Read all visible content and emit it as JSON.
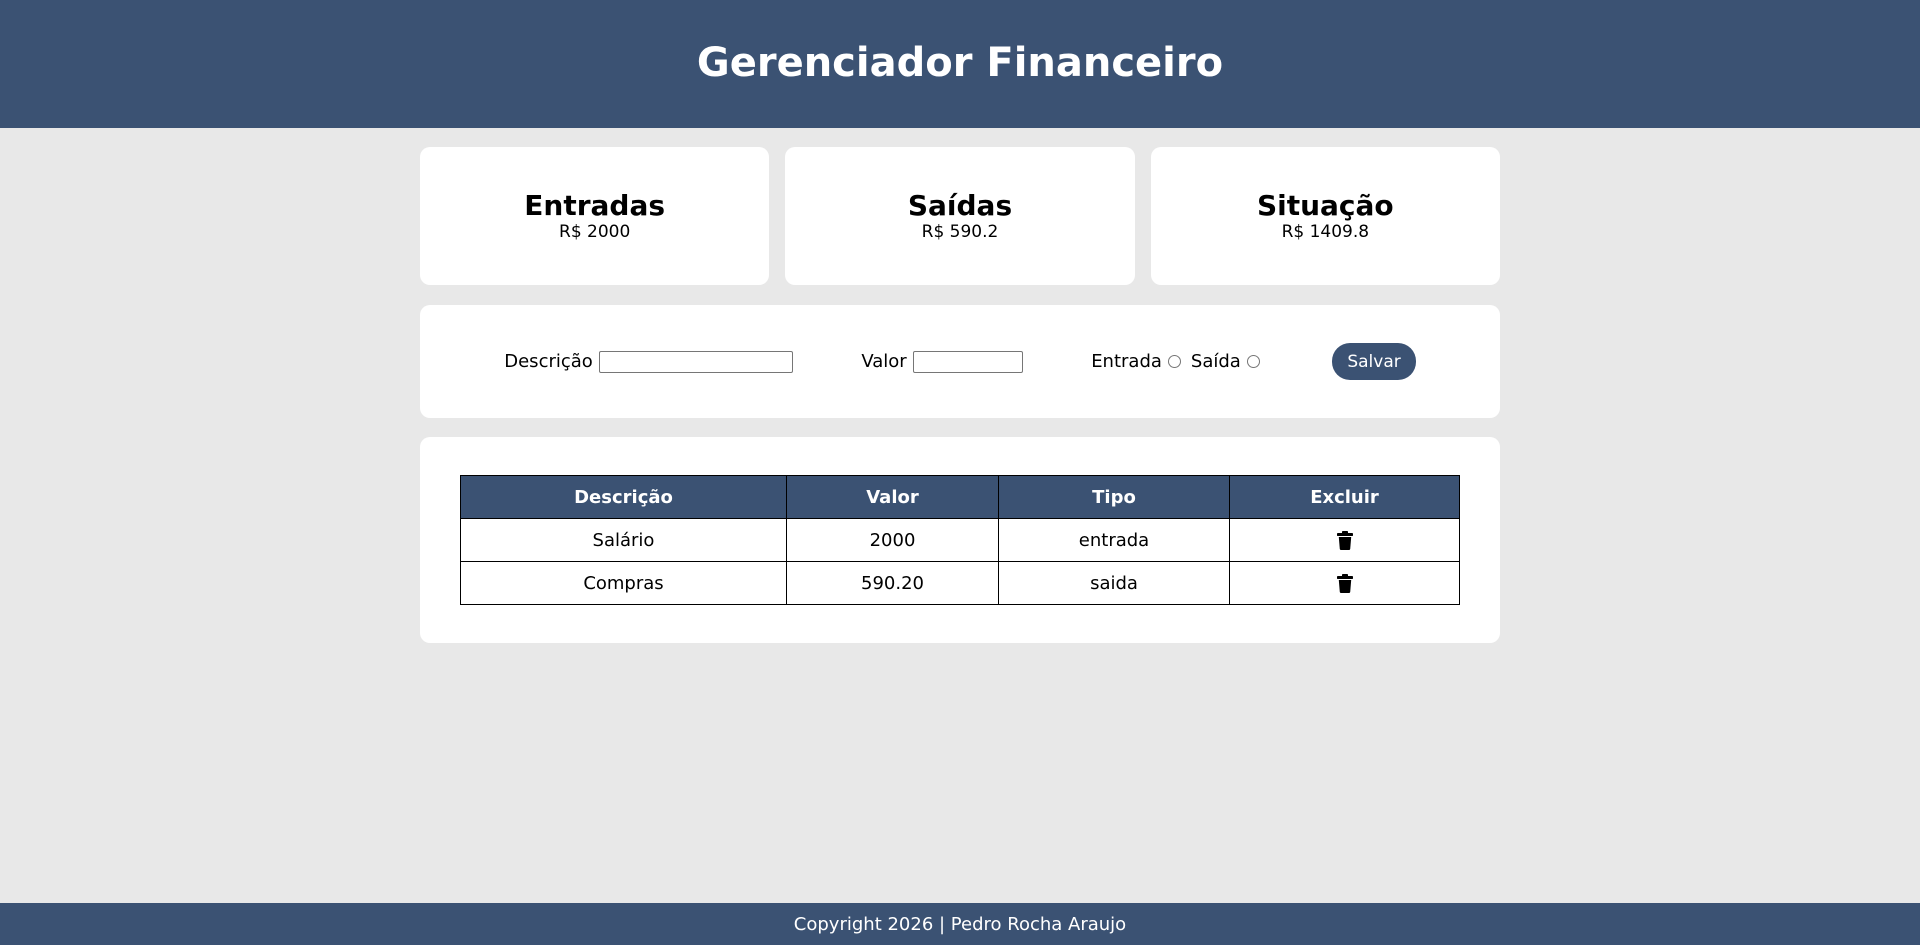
{
  "header": {
    "title": "Gerenciador Financeiro"
  },
  "summary": {
    "income": {
      "label": "Entradas",
      "value": "R$ 2000"
    },
    "expenses": {
      "label": "Saídas",
      "value": "R$ 590.2"
    },
    "balance": {
      "label": "Situação",
      "value": "R$ 1409.8"
    }
  },
  "form": {
    "description_label": "Descrição",
    "description_value": "",
    "amount_label": "Valor",
    "amount_value": "",
    "type_income_label": "Entrada",
    "type_expense_label": "Saída",
    "save_label": "Salvar"
  },
  "table": {
    "headers": [
      "Descrição",
      "Valor",
      "Tipo",
      "Excluir"
    ],
    "rows": [
      {
        "description": "Salário",
        "amount": "2000",
        "type": "entrada"
      },
      {
        "description": "Compras",
        "amount": "590.20",
        "type": "saida"
      }
    ]
  },
  "footer": {
    "text": "Copyright 2026 | Pedro Rocha Araujo"
  },
  "colors": {
    "primary": "#3b5273",
    "background": "#e8e8e8",
    "panel": "#ffffff"
  },
  "icons": {
    "delete": "trash-icon"
  }
}
